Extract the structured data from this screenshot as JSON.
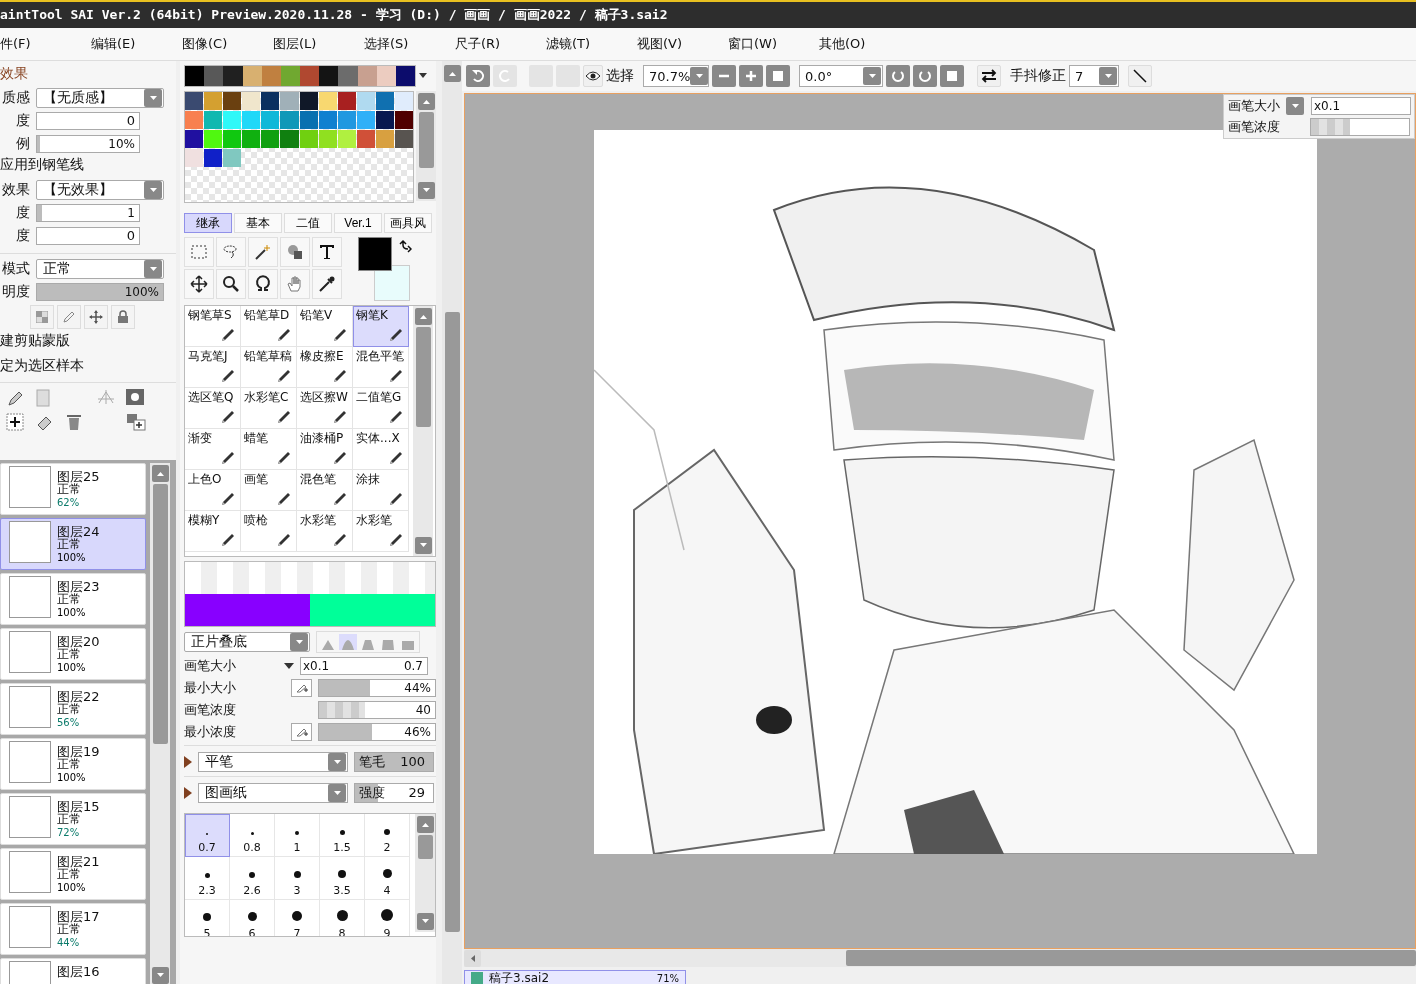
{
  "window": {
    "title": "aintTool SAI Ver.2 (64bit) Preview.2020.11.28 - 学习 (D:) / 画画 / 画画2022 / 稿子3.sai2"
  },
  "menu": [
    "件(F)",
    "编辑(E)",
    "图像(C)",
    "图层(L)",
    "选择(S)",
    "尺子(R)",
    "滤镜(T)",
    "视图(V)",
    "窗口(W)",
    "其他(O)"
  ],
  "properties": {
    "heading": "效果",
    "rows": [
      {
        "kind": "dropdown",
        "label": "质感",
        "value": "【无质感】"
      },
      {
        "kind": "field",
        "label": "度",
        "value": "0"
      },
      {
        "kind": "slider",
        "label": "例",
        "value": "10%",
        "level": 0.03
      },
      {
        "kind": "text",
        "label": "应用到钢笔线"
      },
      {
        "kind": "dropdown",
        "label": "效果",
        "value": "【无效果】"
      },
      {
        "kind": "slider",
        "label": "度",
        "value": "1",
        "level": 0.05
      },
      {
        "kind": "field",
        "label": "度",
        "value": "0"
      },
      {
        "kind": "dropdown",
        "label": "模式",
        "value": "正常"
      },
      {
        "kind": "slider",
        "label": "明度",
        "value": "100%",
        "level": 1
      }
    ],
    "links": [
      "建剪贴蒙版",
      "定为选区样本"
    ]
  },
  "layers": [
    {
      "name": "图层25",
      "mode": "正常",
      "opacity": "62%",
      "color": "#0a7a6a",
      "selected": false
    },
    {
      "name": "图层24",
      "mode": "正常",
      "opacity": "100%",
      "color": "#000000",
      "selected": true
    },
    {
      "name": "图层23",
      "mode": "正常",
      "opacity": "100%",
      "color": "#000000",
      "selected": false
    },
    {
      "name": "图层20",
      "mode": "正常",
      "opacity": "100%",
      "color": "#000000",
      "selected": false
    },
    {
      "name": "图层22",
      "mode": "正常",
      "opacity": "56%",
      "color": "#0a7a6a",
      "selected": false
    },
    {
      "name": "图层19",
      "mode": "正常",
      "opacity": "100%",
      "color": "#000000",
      "selected": false
    },
    {
      "name": "图层15",
      "mode": "正常",
      "opacity": "72%",
      "color": "#0a7a6a",
      "selected": false
    },
    {
      "name": "图层21",
      "mode": "正常",
      "opacity": "100%",
      "color": "#000000",
      "selected": false
    },
    {
      "name": "图层17",
      "mode": "正常",
      "opacity": "44%",
      "color": "#0a7a6a",
      "selected": false
    },
    {
      "name": "图层16",
      "selected": false
    }
  ],
  "palette": {
    "recent": [
      {
        "color": "#000000"
      },
      {
        "color": "#585858"
      },
      {
        "color": "#202020"
      },
      {
        "color": "#d8b070"
      },
      {
        "color": "#c08040"
      },
      {
        "color": "#70a830"
      },
      {
        "color": "#b04830"
      },
      {
        "color": "#141414"
      },
      {
        "color": "#6c6c6c"
      },
      {
        "color": "#c8a090"
      },
      {
        "color": "#ecccc0"
      },
      {
        "color": "#0c0c6c"
      }
    ],
    "swatches": [
      {
        "color": "#3a4a70"
      },
      {
        "color": "#d4a030"
      },
      {
        "color": "#6a4010"
      },
      {
        "color": "#f0e6cc"
      },
      {
        "color": "#0a3060"
      },
      {
        "color": "#a0b0b8"
      },
      {
        "color": "#101828"
      },
      {
        "color": "#f8d870"
      },
      {
        "color": "#a82020"
      },
      {
        "color": "#b0daf0"
      },
      {
        "color": "#1070b0"
      },
      {
        "color": "#e0ecfc"
      },
      {
        "color": "#f88050"
      },
      {
        "color": "#10b8b0"
      },
      {
        "color": "#30f8f8"
      },
      {
        "color": "#20d8f8"
      },
      {
        "color": "#10b8d8"
      },
      {
        "color": "#1098b8"
      },
      {
        "color": "#0870b0"
      },
      {
        "color": "#1080d0"
      },
      {
        "color": "#2098e0"
      },
      {
        "color": "#30b0f8"
      },
      {
        "color": "#081850"
      },
      {
        "color": "#500000"
      },
      {
        "color": "#2010a0"
      },
      {
        "color": "#50f810"
      },
      {
        "color": "#10c810"
      },
      {
        "color": "#10b010"
      },
      {
        "color": "#10a010"
      },
      {
        "color": "#108010"
      },
      {
        "color": "#70d010"
      },
      {
        "color": "#90e020"
      },
      {
        "color": "#b0f040"
      },
      {
        "color": "#d05038"
      },
      {
        "color": "#d8a040"
      },
      {
        "color": "#585450"
      },
      {
        "color": "#f0e0e0"
      },
      {
        "color": "#1020c8"
      },
      {
        "color": "#80c8c0"
      }
    ]
  },
  "brush_tabs": [
    {
      "label": "继承",
      "selected": true
    },
    {
      "label": "基本",
      "selected": false
    },
    {
      "label": "二值",
      "selected": false
    },
    {
      "label": "Ver.1",
      "selected": false
    },
    {
      "label": "画具风",
      "selected": false
    }
  ],
  "colors": [
    {
      "kind": "foreground",
      "color": "#000000"
    },
    {
      "kind": "background",
      "color": "#e8fcfc"
    }
  ],
  "brushes": [
    {
      "name": "钢笔草S",
      "selected": false
    },
    {
      "name": "铅笔草D",
      "selected": false
    },
    {
      "name": "铅笔V",
      "selected": false
    },
    {
      "name": "钢笔K",
      "selected": true
    },
    {
      "name": "马克笔J",
      "selected": false
    },
    {
      "name": "铅笔草稿",
      "selected": false
    },
    {
      "name": "橡皮擦E",
      "selected": false
    },
    {
      "name": "混色平笔",
      "selected": false
    },
    {
      "name": "选区笔Q",
      "selected": false
    },
    {
      "name": "水彩笔C",
      "selected": false
    },
    {
      "name": "选区擦W",
      "selected": false
    },
    {
      "name": "二值笔G",
      "selected": false
    },
    {
      "name": "渐变",
      "selected": false
    },
    {
      "name": "蜡笔",
      "selected": false
    },
    {
      "name": "油漆桶P",
      "selected": false
    },
    {
      "name": "实体...X",
      "selected": false
    },
    {
      "name": "上色O",
      "selected": false
    },
    {
      "name": "画笔",
      "selected": false
    },
    {
      "name": "混色笔",
      "selected": false
    },
    {
      "name": "涂抹",
      "selected": false
    },
    {
      "name": "模糊Y",
      "selected": false
    },
    {
      "name": "喷枪",
      "selected": false
    },
    {
      "name": "水彩笔",
      "selected": false
    },
    {
      "name": "水彩笔",
      "selected": false
    }
  ],
  "mixer": [
    {
      "color": "#8800ff"
    },
    {
      "color": "#00ff99"
    }
  ],
  "brush_settings": {
    "blend_mode": "正片叠底",
    "shapes": [
      {
        "selected": false
      },
      {
        "selected": true
      },
      {
        "selected": false
      },
      {
        "selected": false
      },
      {
        "selected": false
      }
    ],
    "size_label": "画笔大小",
    "size_multiplier": "x0.1",
    "size_value": "0.7",
    "sliders": [
      {
        "label": "最小大小",
        "value": "44%",
        "level": 0.44,
        "kind": "pressure"
      },
      {
        "label": "画笔浓度",
        "value": "40",
        "level": 0.4,
        "kind": "checker"
      },
      {
        "label": "最小浓度",
        "value": "46%",
        "level": 0.46,
        "kind": "pressure"
      }
    ],
    "shape": "平笔",
    "bristle": {
      "label": "笔毛",
      "value": "100",
      "level": 1
    },
    "texture": "图画纸",
    "strength": {
      "label": "强度",
      "value": "29",
      "level": 0.29
    }
  },
  "brush_sizes": [
    {
      "label": "0.7",
      "selected": true
    },
    {
      "label": "0.8",
      "selected": false
    },
    {
      "label": "1",
      "selected": false
    },
    {
      "label": "1.5",
      "selected": false
    },
    {
      "label": "2",
      "selected": false
    },
    {
      "label": "2.3",
      "selected": false
    },
    {
      "label": "2.6",
      "selected": false
    },
    {
      "label": "3",
      "selected": false
    },
    {
      "label": "3.5",
      "selected": false
    },
    {
      "label": "4",
      "selected": false
    },
    {
      "label": "5",
      "selected": false
    },
    {
      "label": "6",
      "selected": false
    },
    {
      "label": "7",
      "selected": false
    },
    {
      "label": "8",
      "selected": false
    },
    {
      "label": "9",
      "selected": false
    }
  ],
  "toolbar": {
    "select_label": "选择",
    "zoom": "70.7%",
    "angle": "0.0°",
    "stabilizer_label": "手抖修正",
    "stabilizer": "7"
  },
  "overlay": {
    "size_label": "画笔大小",
    "size_value": "x0.1",
    "density": {
      "label": "画笔浓度",
      "level": 0.4
    }
  },
  "document_tab": {
    "name": "稿子3.sai2",
    "zoom": "71%"
  }
}
